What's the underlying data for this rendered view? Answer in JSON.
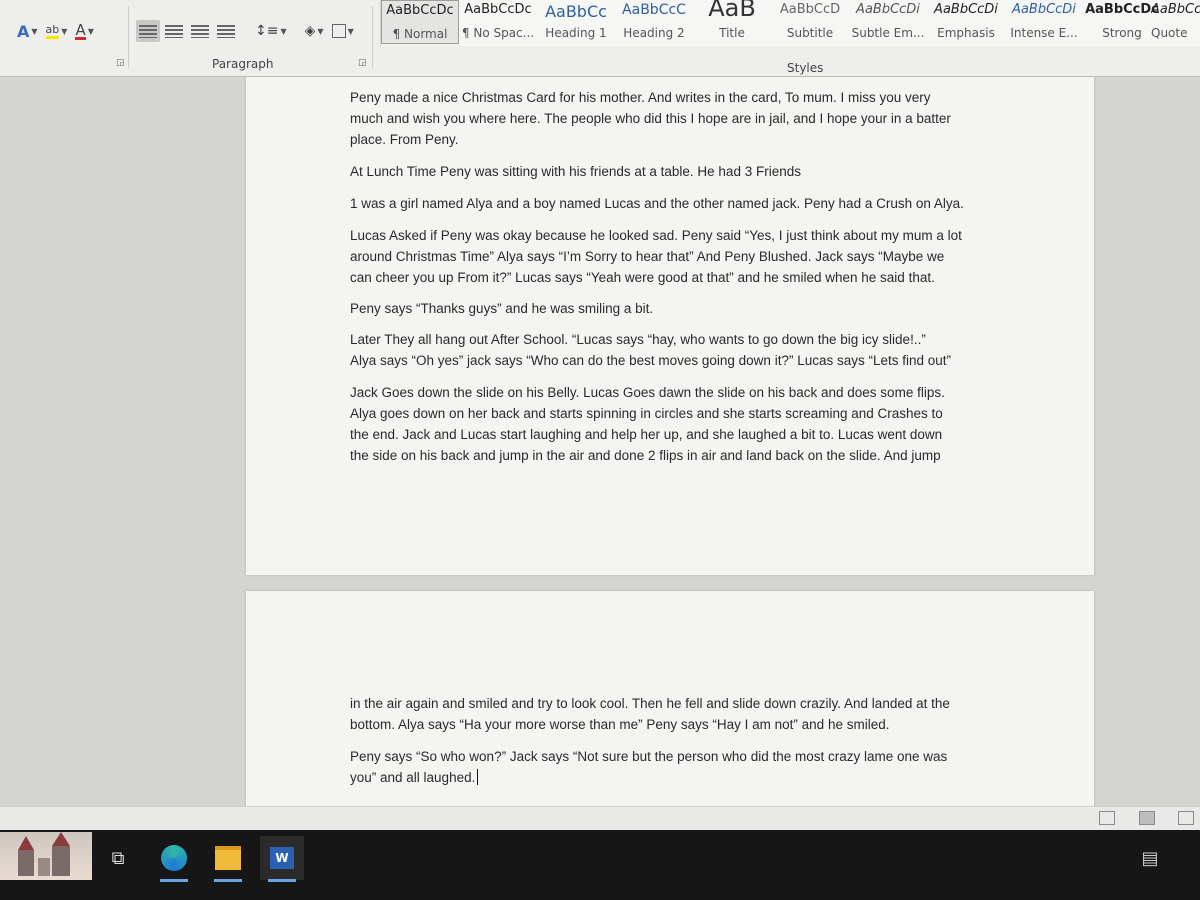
{
  "ribbon": {
    "paragraph_group_label": "Paragraph",
    "styles_group_label": "Styles",
    "font_tools": [
      {
        "icon": "text-effects-icon",
        "glyph": "A"
      },
      {
        "icon": "highlight-color-icon",
        "glyph": "ab"
      },
      {
        "icon": "font-color-icon",
        "glyph": "A"
      }
    ],
    "styles": [
      {
        "sample": "AaBbCcDc",
        "name": "¶ Normal"
      },
      {
        "sample": "AaBbCcDc",
        "name": "¶ No Spac..."
      },
      {
        "sample": "AaBbCc",
        "name": "Heading 1"
      },
      {
        "sample": "AaBbCcC",
        "name": "Heading 2"
      },
      {
        "sample": "AaB",
        "name": "Title"
      },
      {
        "sample": "AaBbCcD",
        "name": "Subtitle"
      },
      {
        "sample": "AaBbCcDi",
        "name": "Subtle Em..."
      },
      {
        "sample": "AaBbCcDi",
        "name": "Emphasis"
      },
      {
        "sample": "AaBbCcDi",
        "name": "Intense E..."
      },
      {
        "sample": "AaBbCcDc",
        "name": "Strong"
      },
      {
        "sample": "AaBbCc",
        "name": "Quote"
      }
    ],
    "colors": {
      "font_color": "#d12a2a",
      "highlight": "#f2e600"
    }
  },
  "document": {
    "page1_paragraphs": [
      [
        "Peny made a nice Christmas Card for his mother. And writes in the card, To mum. I miss you very",
        "much and wish you where here. The people who did this I hope are in jail, and I hope your in a batter",
        "place. From Peny."
      ],
      [
        "At Lunch Time Peny was sitting with his friends at a table. He had 3 Friends"
      ],
      [
        "1 was a girl named Alya and a boy named Lucas and the other named jack. Peny had a Crush on Alya."
      ],
      [
        "Lucas Asked if Peny was okay because he looked sad. Peny said “Yes, I just think about my mum a lot",
        "around Christmas Time” Alya says “I’m Sorry to hear that” And Peny Blushed. Jack says “Maybe we",
        "can cheer you up From it?” Lucas says “Yeah were good at that” and he smiled when he said that."
      ],
      [
        "Peny says “Thanks guys” and he was smiling a bit."
      ],
      [
        "Later They all hang out After School. “Lucas says “hay, who wants to go down the big icy slide!..”",
        "Alya says “Oh yes” jack says “Who can do the best moves going down it?” Lucas says “Lets find out”"
      ],
      [
        "Jack Goes down the slide on his Belly. Lucas Goes dawn the slide on his back and does some flips.",
        "Alya goes down on her back and starts spinning in circles and she starts screaming and Crashes to",
        "the end. Jack and Lucas start laughing and help her up, and she laughed a bit to. Lucas went down",
        "the side on his back and jump in the air and done 2 flips in air and land back on the slide. And jump"
      ]
    ],
    "page2_paragraphs": [
      [
        "in the air again and smiled and try to look cool. Then he fell and slide down crazily. And landed at the",
        "bottom. Alya says “Ha your more worse than me” Peny says “Hay I am not” and he smiled."
      ],
      [
        "Peny says “So who won?” Jack says “Not sure but the person who did the most crazy lame one was",
        "you” and all laughed."
      ]
    ]
  },
  "taskbar": {
    "apps": [
      {
        "name": "task-view-icon",
        "open": false
      },
      {
        "name": "edge-browser-icon",
        "open": true
      },
      {
        "name": "file-explorer-icon",
        "open": true
      },
      {
        "name": "word-app-icon",
        "open": true
      }
    ]
  }
}
